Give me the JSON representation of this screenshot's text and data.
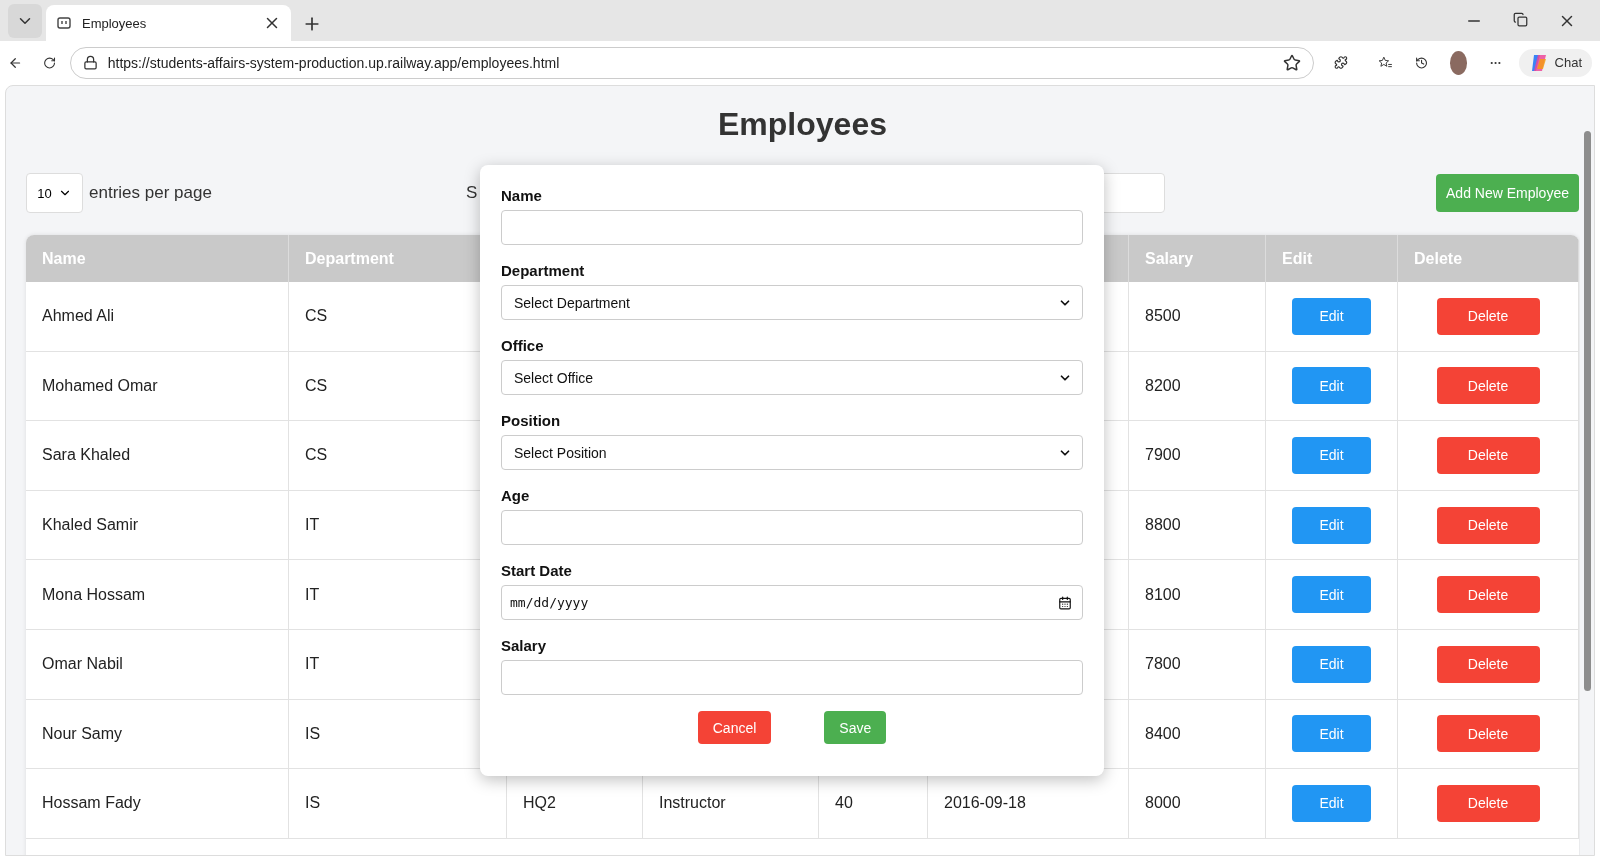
{
  "browser": {
    "tab": {
      "title": "Employees"
    },
    "url": "https://students-affairs-system-production.up.railway.app/employees.html",
    "chat_label": "Chat"
  },
  "page": {
    "title": "Employees",
    "entries": {
      "value": "10",
      "label": "entries per page"
    },
    "search_label": "S",
    "add_button": "Add New Employee",
    "table": {
      "columns_left": [
        "Name",
        "Department"
      ],
      "columns_right": [
        "Salary",
        "Edit",
        "Delete"
      ],
      "rows": [
        {
          "name": "Ahmed Ali",
          "department": "CS",
          "salary": "8500",
          "edit": "Edit",
          "delete": "Delete"
        },
        {
          "name": "Mohamed Omar",
          "department": "CS",
          "salary": "8200",
          "edit": "Edit",
          "delete": "Delete"
        },
        {
          "name": "Sara Khaled",
          "department": "CS",
          "salary": "7900",
          "edit": "Edit",
          "delete": "Delete"
        },
        {
          "name": "Khaled Samir",
          "department": "IT",
          "salary": "8800",
          "edit": "Edit",
          "delete": "Delete"
        },
        {
          "name": "Mona Hossam",
          "department": "IT",
          "salary": "8100",
          "edit": "Edit",
          "delete": "Delete"
        },
        {
          "name": "Omar Nabil",
          "department": "IT",
          "salary": "7800",
          "edit": "Edit",
          "delete": "Delete"
        },
        {
          "name": "Nour Samy",
          "department": "IS",
          "salary": "8400",
          "edit": "Edit",
          "delete": "Delete"
        },
        {
          "name": "Hossam Fady",
          "department": "IS",
          "office": "HQ2",
          "position": "Instructor",
          "age": "40",
          "start_date": "2016-09-18",
          "salary": "8000",
          "edit": "Edit",
          "delete": "Delete"
        }
      ]
    }
  },
  "modal": {
    "fields": [
      {
        "label": "Name",
        "kind": "text"
      },
      {
        "label": "Department",
        "kind": "select",
        "value": "Select Department"
      },
      {
        "label": "Office",
        "kind": "select",
        "value": "Select Office"
      },
      {
        "label": "Position",
        "kind": "select",
        "value": "Select Position"
      },
      {
        "label": "Age",
        "kind": "text"
      },
      {
        "label": "Start Date",
        "kind": "date",
        "placeholder": "mm/dd/yyyy"
      },
      {
        "label": "Salary",
        "kind": "text"
      }
    ],
    "buttons": [
      {
        "label": "Cancel",
        "kind": "cancel"
      },
      {
        "label": "Save",
        "kind": "save"
      }
    ]
  }
}
